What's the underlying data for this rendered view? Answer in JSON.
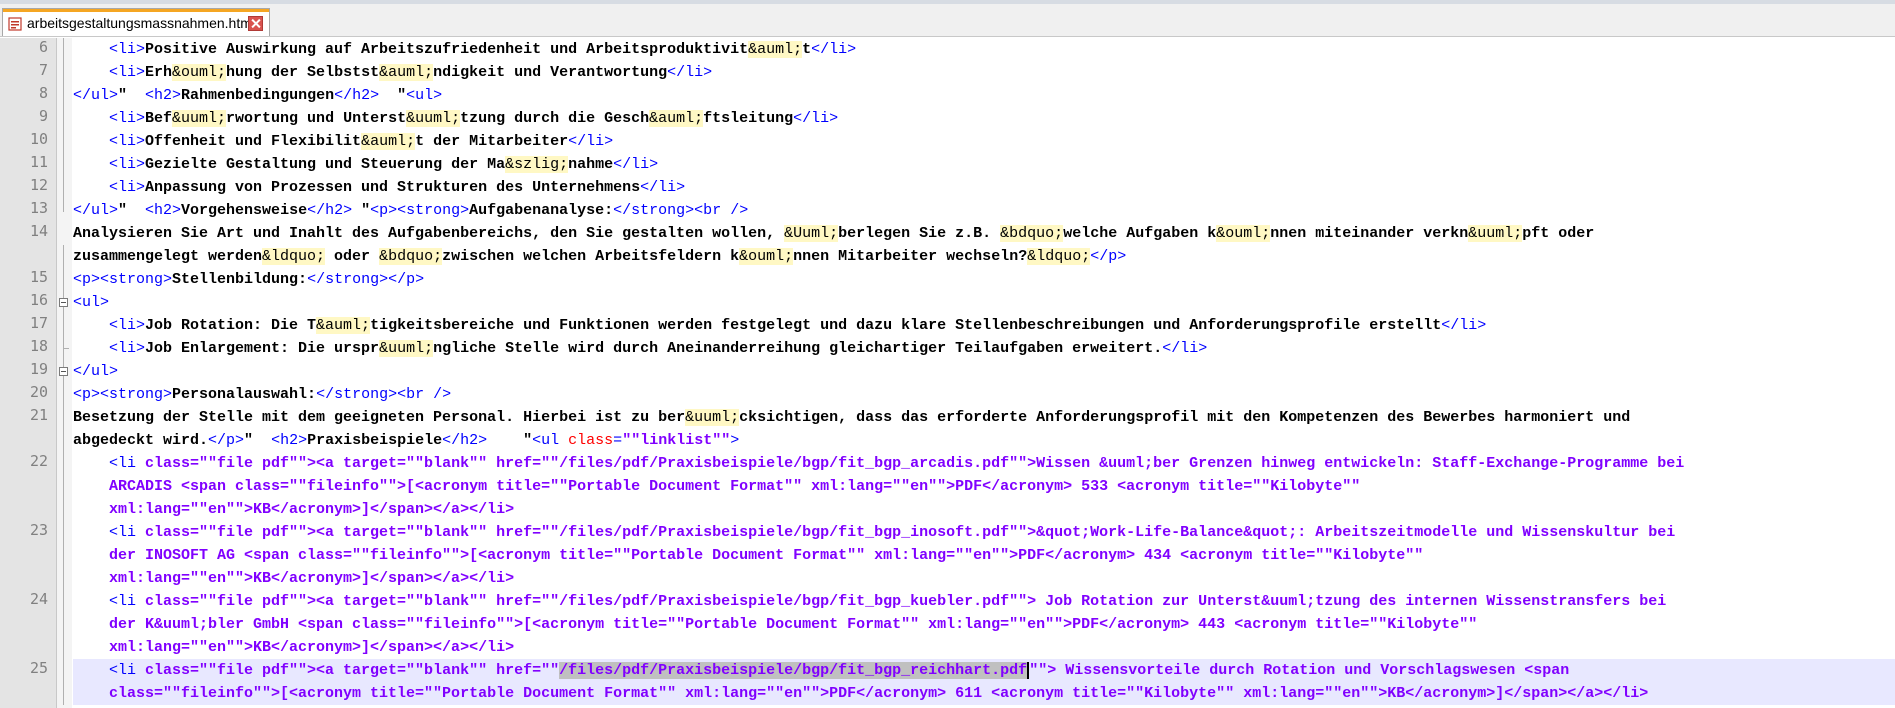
{
  "tab": {
    "filename": "arbeitsgestaltungsmassnahmen.html",
    "file_icon": "html-file-icon",
    "close_icon": "close-icon"
  },
  "colors": {
    "tag": "#0000ff",
    "attribute": "#ff0000",
    "string": "#8000ff",
    "entity_bg": "#fff8c4",
    "current_line": "#e8e8ff",
    "selection": "#c0c0c0"
  },
  "gutter": {
    "line_numbers": [
      "6",
      "7",
      "8",
      "9",
      "10",
      "11",
      "12",
      "13",
      "14",
      "15",
      "16",
      "17",
      "18",
      "19",
      "20",
      "21",
      "22",
      "23",
      "24",
      "25"
    ]
  },
  "selection": {
    "line": "25",
    "text": "/files/pdf/Praxisbeispiele/bgp/fit_bgp_reichhart.pdf"
  },
  "code": {
    "l6": [
      {
        "c": "t",
        "x": "    <li>"
      },
      {
        "c": "",
        "x": "Positive Auswirkung auf Arbeitszufriedenheit und Arbeitsproduktivit"
      },
      {
        "c": "e",
        "x": "&auml;"
      },
      {
        "c": "",
        "x": "t"
      },
      {
        "c": "t",
        "x": "</li>"
      }
    ],
    "l7": [
      {
        "c": "t",
        "x": "    <li>"
      },
      {
        "c": "",
        "x": "Erh"
      },
      {
        "c": "e",
        "x": "&ouml;"
      },
      {
        "c": "",
        "x": "hung der Selbstst"
      },
      {
        "c": "e",
        "x": "&auml;"
      },
      {
        "c": "",
        "x": "ndigkeit und Verantwortung"
      },
      {
        "c": "t",
        "x": "</li>"
      }
    ],
    "l8": [
      {
        "c": "t",
        "x": "</ul>"
      },
      {
        "c": "",
        "x": "\"  "
      },
      {
        "c": "t",
        "x": "<h2>"
      },
      {
        "c": "",
        "x": "Rahmenbedingungen"
      },
      {
        "c": "t",
        "x": "</h2>"
      },
      {
        "c": "",
        "x": "  \""
      },
      {
        "c": "t",
        "x": "<ul>"
      }
    ],
    "l9": [
      {
        "c": "t",
        "x": "    <li>"
      },
      {
        "c": "",
        "x": "Bef"
      },
      {
        "c": "e",
        "x": "&uuml;"
      },
      {
        "c": "",
        "x": "rwortung und Unterst"
      },
      {
        "c": "e",
        "x": "&uuml;"
      },
      {
        "c": "",
        "x": "tzung durch die Gesch"
      },
      {
        "c": "e",
        "x": "&auml;"
      },
      {
        "c": "",
        "x": "ftsleitung"
      },
      {
        "c": "t",
        "x": "</li>"
      }
    ],
    "l10": [
      {
        "c": "t",
        "x": "    <li>"
      },
      {
        "c": "",
        "x": "Offenheit und Flexibilit"
      },
      {
        "c": "e",
        "x": "&auml;"
      },
      {
        "c": "",
        "x": "t der Mitarbeiter"
      },
      {
        "c": "t",
        "x": "</li>"
      }
    ],
    "l11": [
      {
        "c": "t",
        "x": "    <li>"
      },
      {
        "c": "",
        "x": "Gezielte Gestaltung und Steuerung der Ma"
      },
      {
        "c": "e",
        "x": "&szlig;"
      },
      {
        "c": "",
        "x": "nahme"
      },
      {
        "c": "t",
        "x": "</li>"
      }
    ],
    "l12": [
      {
        "c": "t",
        "x": "    <li>"
      },
      {
        "c": "",
        "x": "Anpassung von Prozessen und Strukturen des Unternehmens"
      },
      {
        "c": "t",
        "x": "</li>"
      }
    ],
    "l13": [
      {
        "c": "t",
        "x": "</ul>"
      },
      {
        "c": "",
        "x": "\"  "
      },
      {
        "c": "t",
        "x": "<h2>"
      },
      {
        "c": "",
        "x": "Vorgehensweise"
      },
      {
        "c": "t",
        "x": "</h2>"
      },
      {
        "c": "",
        "x": " \""
      },
      {
        "c": "t",
        "x": "<p><strong>"
      },
      {
        "c": "",
        "x": "Aufgabenanalyse:"
      },
      {
        "c": "t",
        "x": "</strong><br />"
      }
    ],
    "l14a": [
      {
        "c": "",
        "x": "Analysieren Sie Art und Inahlt des Aufgabenbereichs, den Sie gestalten wollen, "
      },
      {
        "c": "e",
        "x": "&Uuml;"
      },
      {
        "c": "",
        "x": "berlegen Sie z.B. "
      },
      {
        "c": "e",
        "x": "&bdquo;"
      },
      {
        "c": "",
        "x": "welche Aufgaben k"
      },
      {
        "c": "e",
        "x": "&ouml;"
      },
      {
        "c": "",
        "x": "nnen miteinander verkn"
      },
      {
        "c": "e",
        "x": "&uuml;"
      },
      {
        "c": "",
        "x": "pft oder"
      }
    ],
    "l14b": [
      {
        "c": "",
        "x": "zusammengelegt werden"
      },
      {
        "c": "e",
        "x": "&ldquo;"
      },
      {
        "c": "",
        "x": " oder "
      },
      {
        "c": "e",
        "x": "&bdquo;"
      },
      {
        "c": "",
        "x": "zwischen welchen Arbeitsfeldern k"
      },
      {
        "c": "e",
        "x": "&ouml;"
      },
      {
        "c": "",
        "x": "nnen Mitarbeiter wechseln?"
      },
      {
        "c": "e",
        "x": "&ldquo;"
      },
      {
        "c": "t",
        "x": "</p>"
      }
    ],
    "l15": [
      {
        "c": "t",
        "x": "<p><strong>"
      },
      {
        "c": "",
        "x": "Stellenbildung:"
      },
      {
        "c": "t",
        "x": "</strong></p>"
      }
    ],
    "l16": [
      {
        "c": "t",
        "x": "<ul>"
      }
    ],
    "l17": [
      {
        "c": "t",
        "x": "    <li>"
      },
      {
        "c": "",
        "x": "Job Rotation: Die T"
      },
      {
        "c": "e",
        "x": "&auml;"
      },
      {
        "c": "",
        "x": "tigkeitsbereiche und Funktionen werden festgelegt und dazu klare Stellenbeschreibungen und Anforderungsprofile erstellt"
      },
      {
        "c": "t",
        "x": "</li>"
      }
    ],
    "l18": [
      {
        "c": "t",
        "x": "    <li>"
      },
      {
        "c": "",
        "x": "Job Enlargement: Die urspr"
      },
      {
        "c": "e",
        "x": "&uuml;"
      },
      {
        "c": "",
        "x": "ngliche Stelle wird durch Aneinanderreihung gleichartiger Teilaufgaben erweitert."
      },
      {
        "c": "t",
        "x": "</li>"
      }
    ],
    "l19": [
      {
        "c": "t",
        "x": "</ul>"
      }
    ],
    "l20": [
      {
        "c": "t",
        "x": "<p><strong>"
      },
      {
        "c": "",
        "x": "Personalauswahl:"
      },
      {
        "c": "t",
        "x": "</strong><br />"
      }
    ],
    "l21a": [
      {
        "c": "",
        "x": "Besetzung der Stelle mit dem geeigneten Personal. Hierbei ist zu ber"
      },
      {
        "c": "e",
        "x": "&uuml;"
      },
      {
        "c": "",
        "x": "cksichtigen, dass das erforderte Anforderungsprofil mit den Kompetenzen des Bewerbes harmoniert und"
      }
    ],
    "l21b": [
      {
        "c": "",
        "x": "abgedeckt wird."
      },
      {
        "c": "t",
        "x": "</p>"
      },
      {
        "c": "",
        "x": "\"  "
      },
      {
        "c": "t",
        "x": "<h2>"
      },
      {
        "c": "",
        "x": "Praxisbeispiele"
      },
      {
        "c": "t",
        "x": "</h2>"
      },
      {
        "c": "",
        "x": "    \""
      },
      {
        "c": "t",
        "x": "<ul "
      },
      {
        "c": "a",
        "x": "class"
      },
      {
        "c": "t",
        "x": "="
      },
      {
        "c": "s",
        "x": "\"\"linklist\"\""
      },
      {
        "c": "t",
        "x": ">"
      }
    ],
    "l22a": [
      {
        "c": "t",
        "x": "    <li "
      },
      {
        "c": "s",
        "x": "class=\"\"file pdf\"\"><a target=\"\"blank\"\" href=\"\"/files/pdf/Praxisbeispiele/bgp/fit_bgp_arcadis.pdf\"\">Wissen &uuml;ber Grenzen hinweg entwickeln: Staff-Exchange-Programme bei"
      }
    ],
    "l22b": [
      {
        "c": "s",
        "x": "    ARCADIS <span class=\"\"fileinfo\"\">[<acronym title=\"\"Portable Document Format\"\" xml:lang=\"\"en\"\">PDF</acronym> 533 <acronym title=\"\"Kilobyte\"\""
      }
    ],
    "l22c": [
      {
        "c": "s",
        "x": "    xml:lang=\"\"en\"\">KB</acronym>]</span></a></li>"
      }
    ],
    "l23a": [
      {
        "c": "t",
        "x": "    <li "
      },
      {
        "c": "s",
        "x": "class=\"\"file pdf\"\"><a target=\"\"blank\"\" href=\"\"/files/pdf/Praxisbeispiele/bgp/fit_bgp_inosoft.pdf\"\">&quot;Work-Life-Balance&quot;: Arbeitszeitmodelle und Wissenskultur bei"
      }
    ],
    "l23b": [
      {
        "c": "s",
        "x": "    der INOSOFT AG <span class=\"\"fileinfo\"\">[<acronym title=\"\"Portable Document Format\"\" xml:lang=\"\"en\"\">PDF</acronym> 434 <acronym title=\"\"Kilobyte\"\""
      }
    ],
    "l23c": [
      {
        "c": "s",
        "x": "    xml:lang=\"\"en\"\">KB</acronym>]</span></a></li>"
      }
    ],
    "l24a": [
      {
        "c": "t",
        "x": "    <li "
      },
      {
        "c": "s",
        "x": "class=\"\"file pdf\"\"><a target=\"\"blank\"\" href=\"\"/files/pdf/Praxisbeispiele/bgp/fit_bgp_kuebler.pdf\"\"> Job Rotation zur Unterst&uuml;tzung des internen Wissenstransfers bei"
      }
    ],
    "l24b": [
      {
        "c": "s",
        "x": "    der K&uuml;bler GmbH <span class=\"\"fileinfo\"\">[<acronym title=\"\"Portable Document Format\"\" xml:lang=\"\"en\"\">PDF</acronym> 443 <acronym title=\"\"Kilobyte\"\""
      }
    ],
    "l24c": [
      {
        "c": "s",
        "x": "    xml:lang=\"\"en\"\">KB</acronym>]</span></a></li>"
      }
    ],
    "l25a": [
      {
        "c": "t",
        "x": "    <li "
      },
      {
        "c": "s",
        "x": "class=\"\"file pdf\"\"><a target=\"\"blank\"\" href=\"\""
      },
      {
        "c": "s sel",
        "x": "/files/pdf/Praxisbeispiele/bgp/fit_bgp_reichhart.pd"
      },
      {
        "c": "s sel caret",
        "x": "f"
      },
      {
        "c": "s",
        "x": "\"\"> Wissensvorteile durch Rotation und Vorschlagswesen <span"
      }
    ],
    "l25b": [
      {
        "c": "s",
        "x": "    class=\"\"fileinfo\"\">[<acronym title=\"\"Portable Document Format\"\" xml:lang=\"\"en\"\">PDF</acronym> 611 <acronym title=\"\"Kilobyte\"\" xml:lang=\"\"en\"\">KB</acronym>]</span></a></li>"
      }
    ]
  }
}
